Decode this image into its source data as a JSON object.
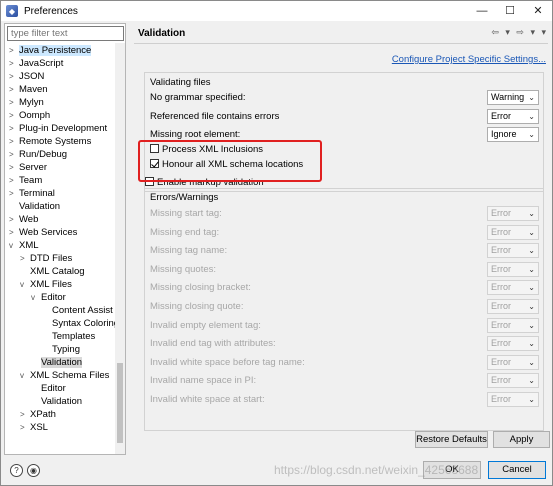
{
  "window": {
    "title": "Preferences",
    "minimize": "—",
    "maximize": "☐",
    "close": "✕"
  },
  "sidebar": {
    "filter_placeholder": "type filter text",
    "items": [
      {
        "label": "Java Persistence",
        "indent": 0,
        "twisty": ">",
        "state": "sel"
      },
      {
        "label": "JavaScript",
        "indent": 0,
        "twisty": ">"
      },
      {
        "label": "JSON",
        "indent": 0,
        "twisty": ">"
      },
      {
        "label": "Maven",
        "indent": 0,
        "twisty": ">"
      },
      {
        "label": "Mylyn",
        "indent": 0,
        "twisty": ">"
      },
      {
        "label": "Oomph",
        "indent": 0,
        "twisty": ">"
      },
      {
        "label": "Plug-in Development",
        "indent": 0,
        "twisty": ">"
      },
      {
        "label": "Remote Systems",
        "indent": 0,
        "twisty": ">"
      },
      {
        "label": "Run/Debug",
        "indent": 0,
        "twisty": ">"
      },
      {
        "label": "Server",
        "indent": 0,
        "twisty": ">"
      },
      {
        "label": "Team",
        "indent": 0,
        "twisty": ">"
      },
      {
        "label": "Terminal",
        "indent": 0,
        "twisty": ">"
      },
      {
        "label": "Validation",
        "indent": 0,
        "twisty": ""
      },
      {
        "label": "Web",
        "indent": 0,
        "twisty": ">"
      },
      {
        "label": "Web Services",
        "indent": 0,
        "twisty": ">"
      },
      {
        "label": "XML",
        "indent": 0,
        "twisty": "v"
      },
      {
        "label": "DTD Files",
        "indent": 1,
        "twisty": ">"
      },
      {
        "label": "XML Catalog",
        "indent": 1,
        "twisty": ""
      },
      {
        "label": "XML Files",
        "indent": 1,
        "twisty": "v"
      },
      {
        "label": "Editor",
        "indent": 2,
        "twisty": "v"
      },
      {
        "label": "Content Assist",
        "indent": 3,
        "twisty": ""
      },
      {
        "label": "Syntax Coloring",
        "indent": 3,
        "twisty": ""
      },
      {
        "label": "Templates",
        "indent": 3,
        "twisty": ""
      },
      {
        "label": "Typing",
        "indent": 3,
        "twisty": ""
      },
      {
        "label": "Validation",
        "indent": 2,
        "twisty": "",
        "state": "cur"
      },
      {
        "label": "XML Schema Files",
        "indent": 1,
        "twisty": "v"
      },
      {
        "label": "Editor",
        "indent": 2,
        "twisty": ""
      },
      {
        "label": "Validation",
        "indent": 2,
        "twisty": ""
      },
      {
        "label": "XPath",
        "indent": 1,
        "twisty": ">"
      },
      {
        "label": "XSL",
        "indent": 1,
        "twisty": ">"
      }
    ]
  },
  "main": {
    "heading": "Validation",
    "nav": "⇦ ▾ ⇨ ▾ ▾",
    "project_link": "Configure Project Specific Settings...",
    "validating_files": {
      "title": "Validating files",
      "rows": [
        {
          "label": "No grammar specified:",
          "value": "Warning"
        },
        {
          "label": "Referenced file contains errors",
          "value": "Error"
        },
        {
          "label": "Missing root element:",
          "value": "Ignore"
        }
      ],
      "process_xinclude": "Process XML Inclusions",
      "honour_schema": "Honour all XML schema locations"
    },
    "enable_markup": "Enable markup validation",
    "errors_warnings": {
      "title": "Errors/Warnings",
      "rows": [
        {
          "label": "Missing start tag:",
          "value": "Error"
        },
        {
          "label": "Missing end tag:",
          "value": "Error"
        },
        {
          "label": "Missing tag name:",
          "value": "Error"
        },
        {
          "label": "Missing quotes:",
          "value": "Error"
        },
        {
          "label": "Missing closing bracket:",
          "value": "Error"
        },
        {
          "label": "Missing closing quote:",
          "value": "Error"
        },
        {
          "label": "Invalid empty element tag:",
          "value": "Error"
        },
        {
          "label": "Invalid end tag with attributes:",
          "value": "Error"
        },
        {
          "label": "Invalid white space before tag name:",
          "value": "Error"
        },
        {
          "label": "Invalid name space in PI:",
          "value": "Error"
        },
        {
          "label": "Invalid white space at start:",
          "value": "Error"
        }
      ]
    },
    "restore_defaults": "Restore Defaults",
    "apply": "Apply"
  },
  "bottom": {
    "help": "?",
    "ok": "OK",
    "cancel": "Cancel",
    "watermark": "https://blog.csdn.net/weixin_42563688"
  },
  "colors": {
    "highlight": "#e02020",
    "link": "#1a57b6",
    "selection": "#cce8ff"
  }
}
